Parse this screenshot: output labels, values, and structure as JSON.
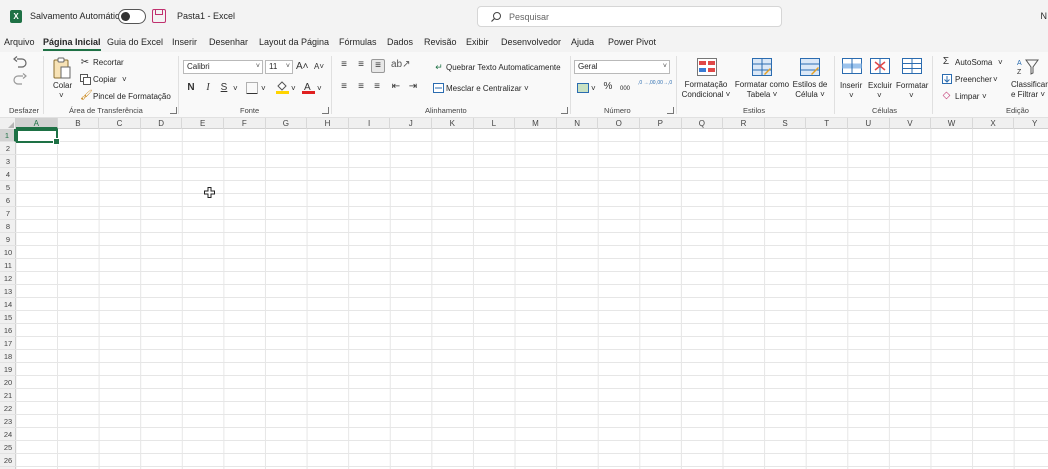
{
  "titlebar": {
    "app_logo": "X",
    "autosave_label": "Salvamento Automático",
    "doc_title": "Pasta1  -  Excel",
    "search_placeholder": "Pesquisar",
    "right_initial": "N"
  },
  "menu": {
    "tabs": [
      "Arquivo",
      "Página Inicial",
      "Guia do Excel",
      "Inserir",
      "Desenhar",
      "Layout da Página",
      "Fórmulas",
      "Dados",
      "Revisão",
      "Exibir",
      "Desenvolvedor",
      "Ajuda",
      "Power Pivot"
    ],
    "active": "Página Inicial"
  },
  "ribbon": {
    "undo_group": "Desfazer",
    "clipboard": {
      "paste": "Colar",
      "cut": "Recortar",
      "copy": "Copiar",
      "format_painter": "Pincel de Formatação",
      "group": "Área de Transferência"
    },
    "font": {
      "name": "Calibri",
      "size": "11",
      "grow": "A˄",
      "shrink": "A˅",
      "bold": "N",
      "italic": "I",
      "underline": "S",
      "group": "Fonte"
    },
    "alignment": {
      "wrap": "Quebrar Texto Automaticamente",
      "merge": "Mesclar e Centralizar",
      "group": "Alinhamento"
    },
    "number": {
      "format": "Geral",
      "percent": "%",
      "thousands": "000",
      "inc_decimal": ",0 →,00",
      "dec_decimal": ",00→,0",
      "group": "Número"
    },
    "styles": {
      "conditional": [
        "Formatação",
        "Condicional ˅"
      ],
      "as_table": [
        "Formatar como",
        "Tabela ˅"
      ],
      "cell_styles": [
        "Estilos de",
        "Célula ˅"
      ],
      "group": "Estilos"
    },
    "cells": {
      "insert": "Inserir",
      "delete": "Excluir",
      "format": "Formatar",
      "group": "Células"
    },
    "editing": {
      "autosum": "AutoSoma",
      "fill": "Preencher",
      "clear": "Limpar",
      "sort": [
        "Classificar",
        "e Filtrar ˅"
      ],
      "group": "Edição"
    }
  },
  "grid": {
    "columns": [
      "A",
      "B",
      "C",
      "D",
      "E",
      "F",
      "G",
      "H",
      "I",
      "J",
      "K",
      "L",
      "M",
      "N",
      "O",
      "P",
      "Q",
      "R",
      "S",
      "T",
      "U",
      "V",
      "W",
      "X",
      "Y"
    ],
    "rows": [
      "1",
      "2",
      "3",
      "4",
      "5",
      "6",
      "7",
      "8",
      "9",
      "10",
      "11",
      "12",
      "13",
      "14",
      "15",
      "16",
      "17",
      "18",
      "19",
      "20",
      "21",
      "22",
      "23",
      "24",
      "25",
      "26"
    ],
    "active_cell": "A1"
  },
  "colors": {
    "accent": "#1e7145",
    "titlebar_bg": "#f3f3f3",
    "save_icon": "#c0306e"
  }
}
